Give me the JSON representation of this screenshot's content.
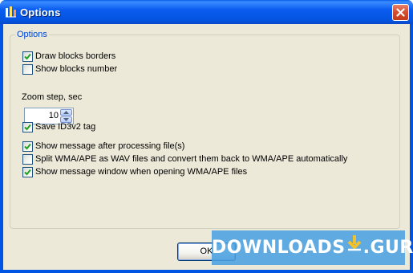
{
  "window": {
    "title": "Options"
  },
  "options_group": {
    "legend": "Options",
    "draw_blocks_borders": {
      "label": "Draw blocks borders",
      "checked": true
    },
    "show_blocks_number": {
      "label": "Show blocks number",
      "checked": false
    },
    "zoom_step": {
      "label": "Zoom step, sec",
      "value": "10"
    },
    "save_id3v2_tag": {
      "label": "Save ID3v2 tag",
      "checked": true
    },
    "show_message_after_processing": {
      "label": "Show message after processing file(s)",
      "checked": true
    },
    "split_wma_ape": {
      "label": "Split WMA/APE as WAV files and convert them back to WMA/APE automatically",
      "checked": false
    },
    "show_message_window_wma_ape": {
      "label": "Show message window when opening WMA/APE files",
      "checked": true
    }
  },
  "buttons": {
    "ok_label": "OK"
  },
  "watermark": {
    "left_text": "DOWNLOADS",
    "right_text": ".GURU"
  },
  "colors": {
    "titlebar": "#0054e3",
    "dialog_bg": "#ece9d8",
    "group_legend": "#0046d5",
    "check_mark": "#21a121",
    "watermark_bg": "#4aa0e1",
    "watermark_arrow": "#f2c12e"
  }
}
